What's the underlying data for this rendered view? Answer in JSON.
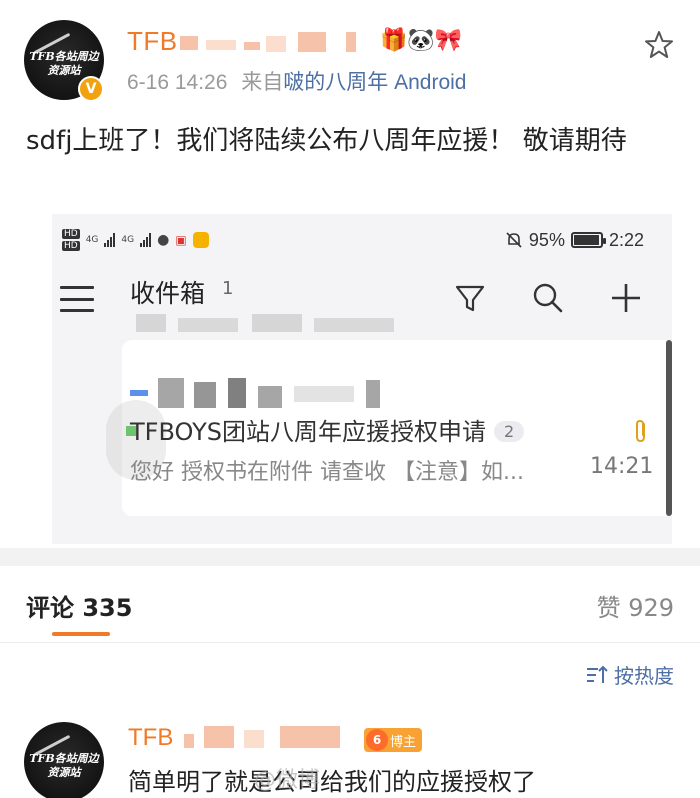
{
  "post": {
    "username": "TFB",
    "avatar_text_line1": "TFB各站周边",
    "avatar_text_line2": "资源站",
    "verified_mark": "V",
    "time": "6-16 14:26",
    "source_prefix": "来自",
    "source": "啵的八周年 Android",
    "emoji_badges": "🎁🐼🎀",
    "text": "sdfj上班了！我们将陆续公布八周年应援！ 敬请期待"
  },
  "embed": {
    "status_bar": {
      "hd1": "HD",
      "hd2": "HD",
      "net1": "4G",
      "net2": "4G",
      "battery_percent": "95%",
      "time": "2:22"
    },
    "inbox_title": "收件箱",
    "inbox_count": "1",
    "mail": {
      "subject": "TFBOYS团站八周年应援授权申请",
      "thread_count": "2",
      "preview": "您好 授权书在附件 请查收 【注意】如...",
      "time": "14:21"
    }
  },
  "comments": {
    "tab_label": "评论 335",
    "likes_label": "赞 929",
    "sort_label": "按热度",
    "first": {
      "username": "TFB",
      "level": "6",
      "badge": "博主",
      "text": "简单明了就是公司给我们的应援授权了",
      "watermark": "@微博"
    }
  },
  "colors": {
    "accent_orange": "#f07a28",
    "link_blue": "#4d6fa3",
    "badge_gold": "#f2a20c"
  }
}
